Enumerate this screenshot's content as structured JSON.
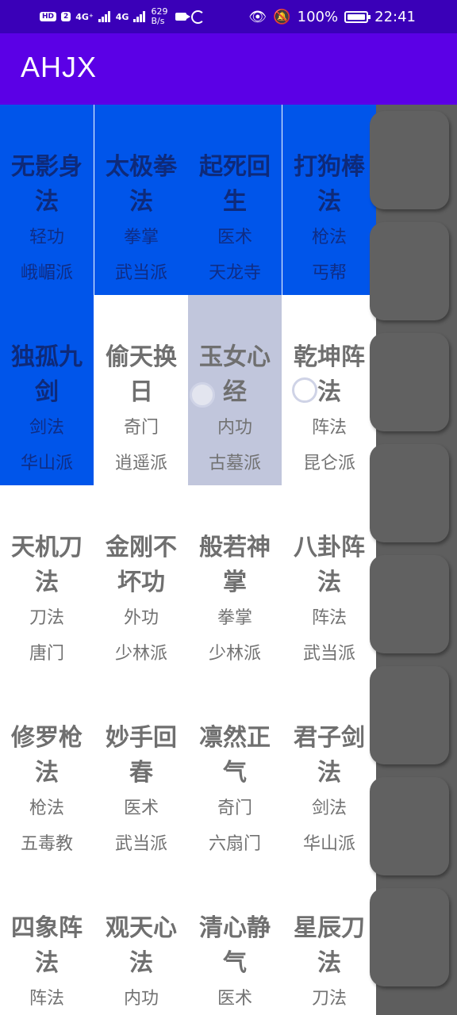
{
  "status_bar": {
    "network_badge": "HD",
    "sim_badge": "2",
    "signal1_label": "4G⁺",
    "signal2_label": "4G",
    "speed_value": "629",
    "speed_unit": "B/s",
    "battery": "100%",
    "time": "22:41"
  },
  "app_bar": {
    "title": "AHJX"
  },
  "skills": [
    {
      "name": "无影身法",
      "category": "轻功",
      "sect": "峨嵋派"
    },
    {
      "name": "太极拳法",
      "category": "拳掌",
      "sect": "武当派"
    },
    {
      "name": "起死回生",
      "category": "医术",
      "sect": "天龙寺"
    },
    {
      "name": "打狗棒法",
      "category": "枪法",
      "sect": "丐帮"
    },
    {
      "name": "独孤九剑",
      "category": "剑法",
      "sect": "华山派"
    },
    {
      "name": "偷天换日",
      "category": "奇门",
      "sect": "逍遥派"
    },
    {
      "name": "玉女心经",
      "category": "内功",
      "sect": "古墓派"
    },
    {
      "name": "乾坤阵法",
      "category": "阵法",
      "sect": "昆仑派"
    },
    {
      "name": "天机刀法",
      "category": "刀法",
      "sect": "唐门"
    },
    {
      "name": "金刚不坏功",
      "category": "外功",
      "sect": "少林派"
    },
    {
      "name": "般若神掌",
      "category": "拳掌",
      "sect": "少林派"
    },
    {
      "name": "八卦阵法",
      "category": "阵法",
      "sect": "武当派"
    },
    {
      "name": "修罗枪法",
      "category": "枪法",
      "sect": "五毒教"
    },
    {
      "name": "妙手回春",
      "category": "医术",
      "sect": "武当派"
    },
    {
      "name": "凛然正气",
      "category": "奇门",
      "sect": "六扇门"
    },
    {
      "name": "君子剑法",
      "category": "剑法",
      "sect": "华山派"
    },
    {
      "name": "四象阵法",
      "category": "阵法",
      "sect": "　"
    },
    {
      "name": "观天心法",
      "category": "内功",
      "sect": "　"
    },
    {
      "name": "清心静气",
      "category": "医术",
      "sect": "　"
    },
    {
      "name": "星辰刀法",
      "category": "刀法",
      "sect": "　"
    }
  ],
  "colors": {
    "status_bar": "#3a00b8",
    "app_bar": "#5b00e6",
    "selected_cell": "#0055ea",
    "pressed_cell": "#c1c6dc",
    "overlay_panel": "#5e5e5e"
  }
}
